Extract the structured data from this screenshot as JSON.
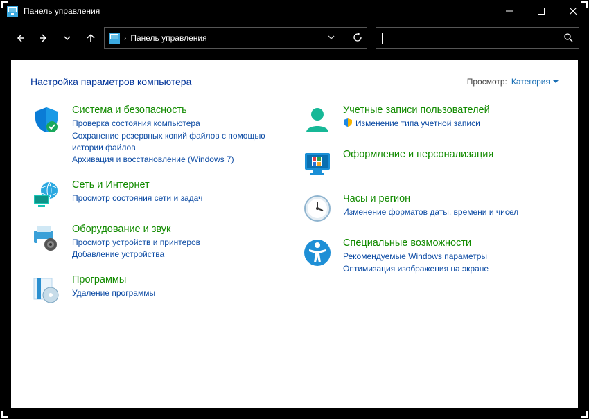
{
  "window": {
    "title": "Панель управления"
  },
  "address": {
    "crumb": "Панель управления"
  },
  "search": {
    "placeholder": ""
  },
  "heading": "Настройка параметров компьютера",
  "view": {
    "label": "Просмотр:",
    "value": "Категория"
  },
  "left": [
    {
      "title": "Система и безопасность",
      "links": [
        "Проверка состояния компьютера",
        "Сохранение резервных копий файлов с помощью истории файлов",
        "Архивация и восстановление (Windows 7)"
      ]
    },
    {
      "title": "Сеть и Интернет",
      "links": [
        "Просмотр состояния сети и задач"
      ]
    },
    {
      "title": "Оборудование и звук",
      "links": [
        "Просмотр устройств и принтеров",
        "Добавление устройства"
      ]
    },
    {
      "title": "Программы",
      "links": [
        "Удаление программы"
      ]
    }
  ],
  "right": [
    {
      "title": "Учетные записи пользователей",
      "links": [
        "Изменение типа учетной записи"
      ],
      "shield": true
    },
    {
      "title": "Оформление и персонализация",
      "links": []
    },
    {
      "title": "Часы и регион",
      "links": [
        "Изменение форматов даты, времени и чисел"
      ]
    },
    {
      "title": "Специальные возможности",
      "links": [
        "Рекомендуемые Windows параметры",
        "Оптимизация изображения на экране"
      ]
    }
  ]
}
